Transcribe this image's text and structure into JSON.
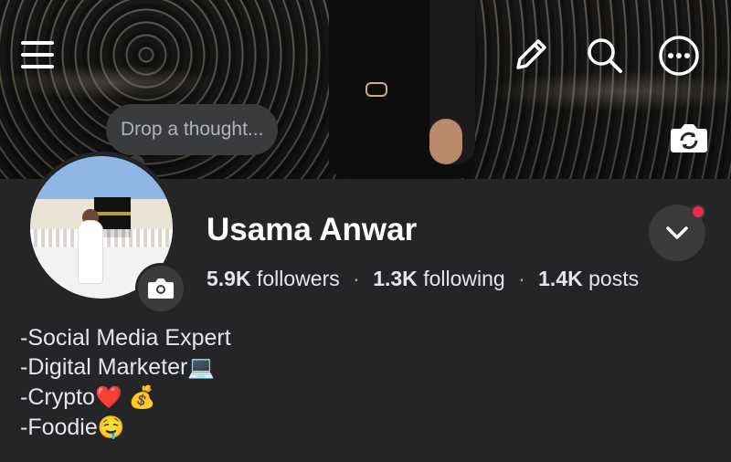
{
  "icons": {
    "menu": "hamburger-menu-icon",
    "edit": "pencil-icon",
    "search": "search-icon",
    "more": "more-dots-icon",
    "cover_camera": "camera-rotate-icon",
    "avatar_camera": "camera-icon",
    "chevron": "chevron-down-icon"
  },
  "thought_placeholder": "Drop a thought...",
  "profile": {
    "name": "Usama Anwar",
    "followers_count": "5.9K",
    "followers_label": "followers",
    "following_count": "1.3K",
    "following_label": "following",
    "posts_count": "1.4K",
    "posts_label": "posts",
    "separator": "·"
  },
  "bio": [
    {
      "text": "-Social Media Expert",
      "emoji": ""
    },
    {
      "text": "-Digital Marketer",
      "emoji": "💻"
    },
    {
      "text": "-Crypto",
      "emoji": "❤️ 💰"
    },
    {
      "text": "-Foodie",
      "emoji": "🤤"
    }
  ],
  "colors": {
    "background": "#242526",
    "surface": "#3a3b3c",
    "notification": "#f02849",
    "text": "#e4e6eb"
  }
}
